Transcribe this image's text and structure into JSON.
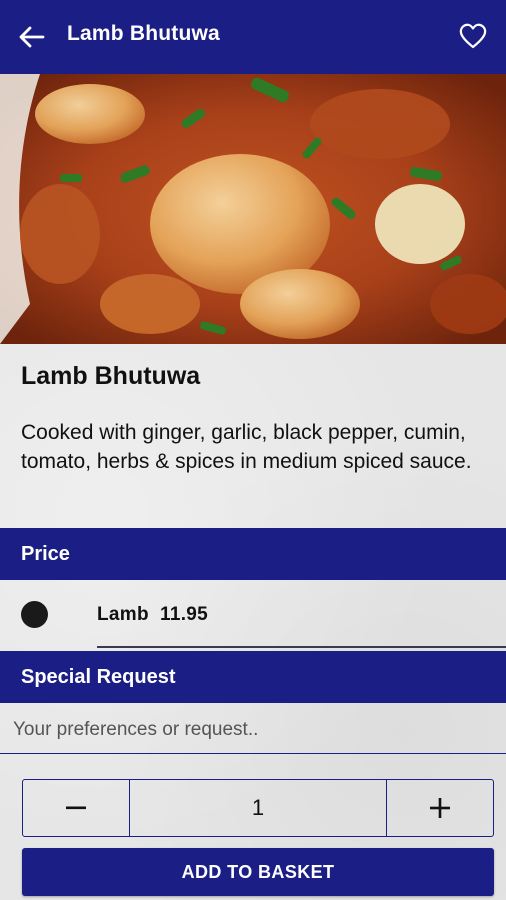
{
  "appbar": {
    "title": "Lamb Bhutuwa",
    "back_icon": "arrow-left-icon",
    "favorite_icon": "heart-outline-icon"
  },
  "dish": {
    "name": "Lamb Bhutuwa",
    "description": "Cooked with ginger, garlic, black pepper, cumin, tomato, herbs & spices in medium spiced sauce."
  },
  "price_section": {
    "header": "Price",
    "options": [
      {
        "name": "Lamb",
        "price": "11.95",
        "selected": true
      }
    ]
  },
  "request_section": {
    "header": "Special Request",
    "placeholder": "Your preferences or request.."
  },
  "quantity": {
    "value": "1",
    "minus_label": "−",
    "plus_label": "+"
  },
  "basket_button": {
    "label": "ADD TO BASKET"
  },
  "colors": {
    "brand": "#1b1f85",
    "background": "#e6e6e6"
  }
}
